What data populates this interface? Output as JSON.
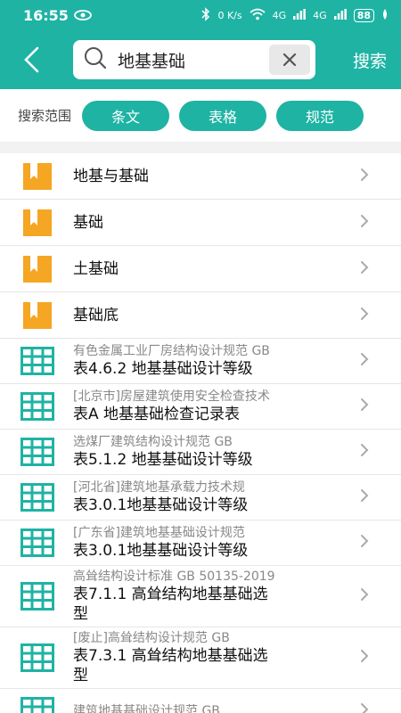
{
  "status": {
    "time": "16:55",
    "network_speed": "0 K/s",
    "signal_4g_1": "4G",
    "signal_4g_2": "4G",
    "battery": "88"
  },
  "header": {
    "search_value": "地基基础",
    "search_button": "搜索"
  },
  "scope": {
    "label": "搜索范围",
    "chips": [
      "条文",
      "表格",
      "规范"
    ]
  },
  "results": [
    {
      "kind": "book",
      "title": "地基与基础"
    },
    {
      "kind": "book",
      "title": "基础"
    },
    {
      "kind": "book",
      "title": "土基础"
    },
    {
      "kind": "book",
      "title": "基础底"
    },
    {
      "kind": "table",
      "source": "有色金属工业厂房结构设计规范 GB",
      "title": "表4.6.2 地基基础设计等级"
    },
    {
      "kind": "table",
      "source": "[北京市]房屋建筑使用安全检查技术",
      "title": "表A 地基基础检查记录表"
    },
    {
      "kind": "table",
      "source": "选煤厂建筑结构设计规范 GB",
      "title": "表5.1.2 地基基础设计等级"
    },
    {
      "kind": "table",
      "source": "[河北省]建筑地基承载力技术规",
      "title": "表3.0.1地基基础设计等级"
    },
    {
      "kind": "table",
      "source": "[广东省]建筑地基基础设计规范",
      "title": "表3.0.1地基基础设计等级"
    },
    {
      "kind": "table",
      "source": "高耸结构设计标准 GB 50135-2019",
      "title": "表7.1.1 高耸结构地基基础选",
      "title2": "型"
    },
    {
      "kind": "table",
      "source": "[废止]高耸结构设计规范 GB",
      "title": "表7.3.1 高耸结构地基基础选",
      "title2": "型"
    },
    {
      "kind": "table",
      "source": "建筑地基基础设计规范 GB",
      "title": ""
    }
  ],
  "colors": {
    "accent": "#1fb3a4",
    "book_icon": "#f5a623",
    "table_icon": "#1fb3a4"
  }
}
